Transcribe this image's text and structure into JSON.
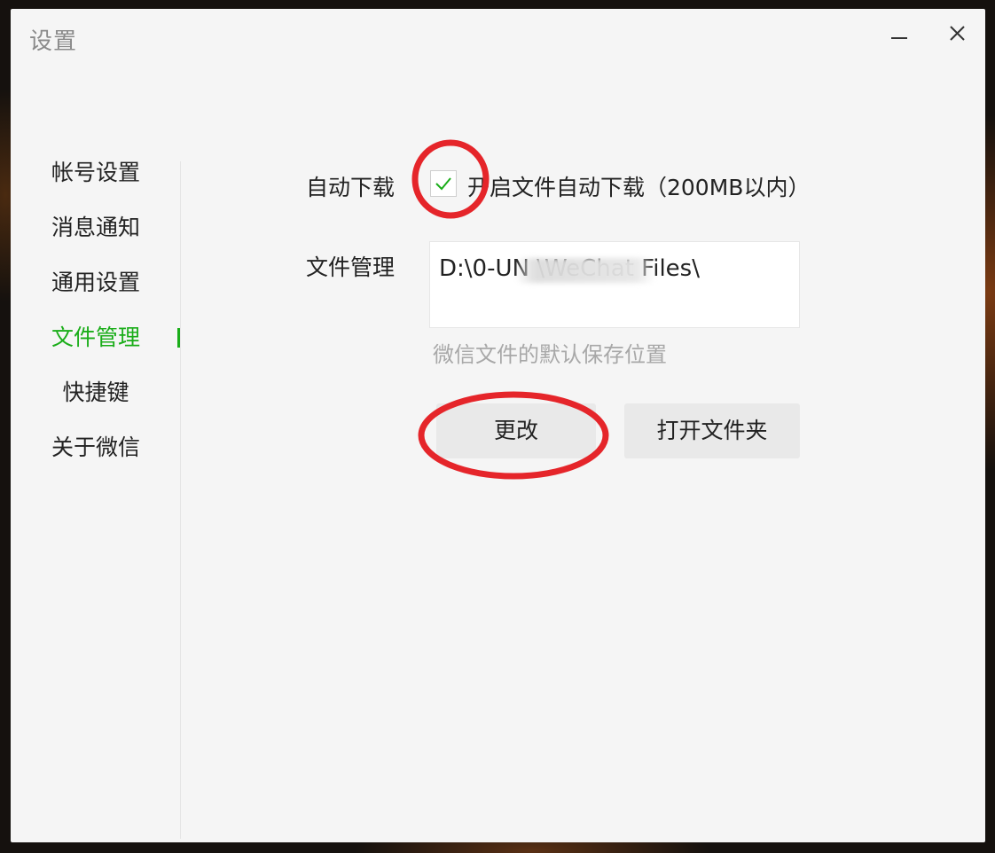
{
  "window": {
    "title": "设置"
  },
  "sidebar": {
    "items": [
      {
        "label": "帐号设置",
        "active": false
      },
      {
        "label": "消息通知",
        "active": false
      },
      {
        "label": "通用设置",
        "active": false
      },
      {
        "label": "文件管理",
        "active": true
      },
      {
        "label": "快捷键",
        "active": false
      },
      {
        "label": "关于微信",
        "active": false
      }
    ]
  },
  "main": {
    "auto_download": {
      "label": "自动下载",
      "checkbox_checked": true,
      "checkbox_label": "开启文件自动下载（200MB以内）"
    },
    "file_management": {
      "label": "文件管理",
      "path": "D:\\0-UN                    \\WeChat Files\\",
      "hint": "微信文件的默认保存位置"
    },
    "buttons": {
      "change": "更改",
      "open_folder": "打开文件夹"
    }
  },
  "icons": {
    "minimize": "minimize-icon",
    "close": "close-icon",
    "check": "check-icon"
  },
  "colors": {
    "accent": "#1aad19",
    "annotation": "#e5252a"
  }
}
